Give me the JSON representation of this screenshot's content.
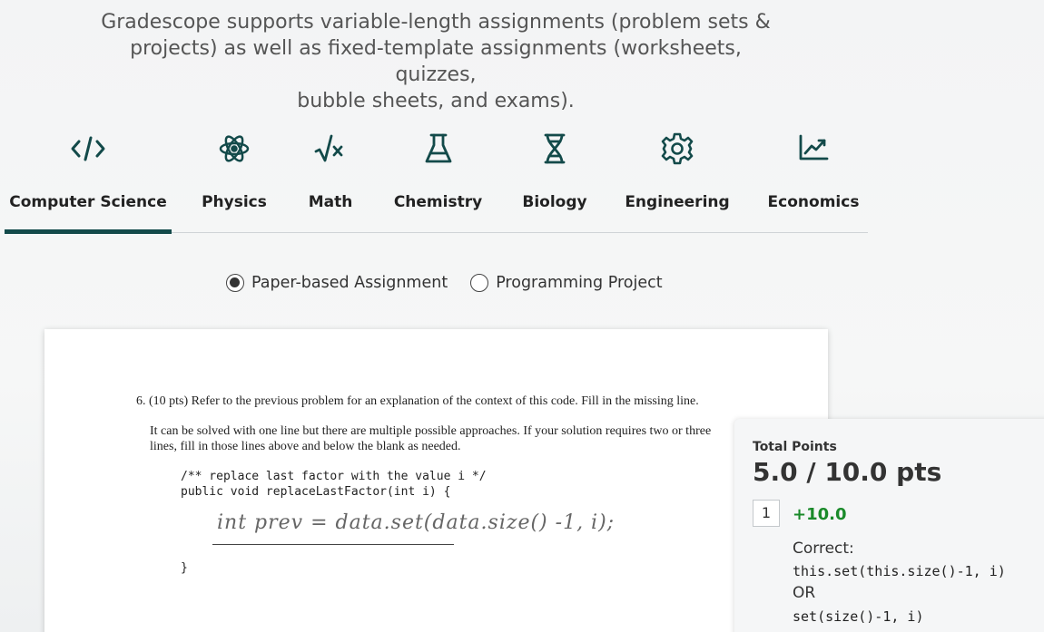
{
  "intro": {
    "line1": "Gradescope supports variable-length assignments (problem sets &",
    "line2": "projects) as well as fixed-template assignments (worksheets, quizzes,",
    "line3": "bubble sheets, and exams)."
  },
  "tabs": [
    {
      "label": "Computer Science",
      "icon": "code-icon",
      "active": true
    },
    {
      "label": "Physics",
      "icon": "atom-icon",
      "active": false
    },
    {
      "label": "Math",
      "icon": "square-root-icon",
      "active": false
    },
    {
      "label": "Chemistry",
      "icon": "flask-icon",
      "active": false
    },
    {
      "label": "Biology",
      "icon": "dna-icon",
      "active": false
    },
    {
      "label": "Engineering",
      "icon": "gear-icon",
      "active": false
    },
    {
      "label": "Economics",
      "icon": "chart-trend-icon",
      "active": false
    }
  ],
  "accent_color": "#134a4a",
  "assignment_type": {
    "options": [
      {
        "label": "Paper-based Assignment",
        "selected": true
      },
      {
        "label": "Programming Project",
        "selected": false
      }
    ]
  },
  "question": {
    "title": "6. (10 pts) Refer to the previous problem for an explanation of the context of this code. Fill in the missing line.",
    "body_line1": "It can be solved with one line but there are multiple possible approaches. If your solution requires two or three",
    "body_line2": "lines, fill in those lines above and below the blank as needed.",
    "code_comment": "/** replace last factor with the value i */",
    "code_signature": "public void replaceLastFactor(int i) {",
    "handwritten_answer": "int prev = data.set(data.size() -1, i);",
    "code_close": "}"
  },
  "grading": {
    "total_label": "Total Points",
    "total_value": "5.0 / 10.0 pts",
    "rubric_item": {
      "number": "1",
      "points": "+10.0",
      "text": "Correct:",
      "line1": "this.set(this.size()-1, i)",
      "line2": "OR",
      "line3": "set(size()-1, i)"
    },
    "points_color": "#1a8a2a"
  }
}
